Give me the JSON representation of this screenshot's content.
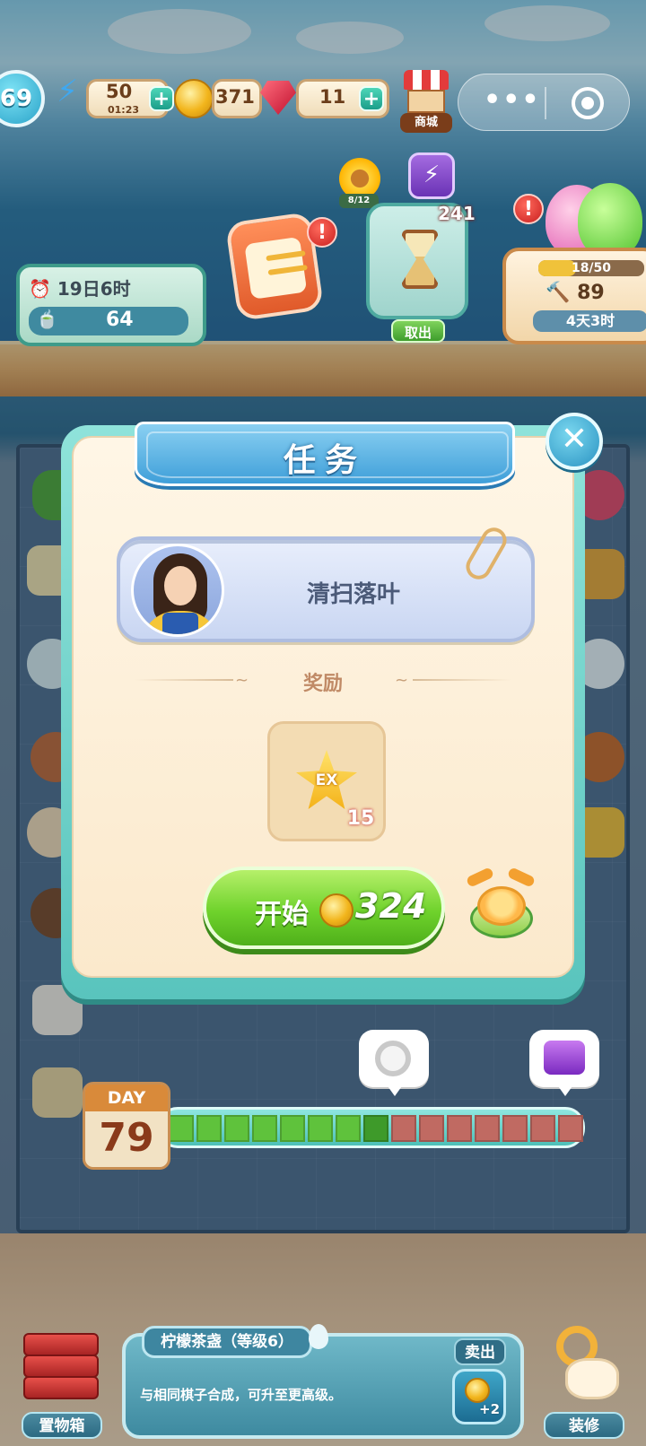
{
  "hud": {
    "level": "69",
    "energy": "50",
    "energy_timer": "01:23",
    "coins": "371",
    "gems": "11",
    "shop_label": "商城",
    "sunflower_progress": "8/12",
    "hourglass_count": "241",
    "takeout_label": "取出",
    "event_timer": "19日6时",
    "event_points": "64",
    "egg_energy": "18/50",
    "egg_energy_fraction": 0.36,
    "hammers": "89",
    "egg_time_left": "4天3时"
  },
  "modal": {
    "title": "任务",
    "close_icon": "close-icon",
    "task_name": "清扫落叶",
    "reward_title": "奖励",
    "reward_item": "EX",
    "reward_qty": "15",
    "start_label": "开始",
    "start_cost": "324"
  },
  "day_progress": {
    "day_label": "DAY",
    "day_number": "79",
    "segments_total": 15,
    "segments_done": 8
  },
  "bottom": {
    "storage_label": "置物箱",
    "item_name": "柠檬茶盏（等级6）",
    "item_desc": "与相同棋子合成，可升至更高级。",
    "sell_label": "卖出",
    "sell_amount": "+2",
    "decorate_label": "装修"
  },
  "colors": {
    "start_button": "#6fd22c",
    "title_ribbon": "#3f9fd9",
    "modal_frame": "#59c4bd",
    "progress_done": "#5fc23c",
    "progress_todo": "#c06a62"
  }
}
